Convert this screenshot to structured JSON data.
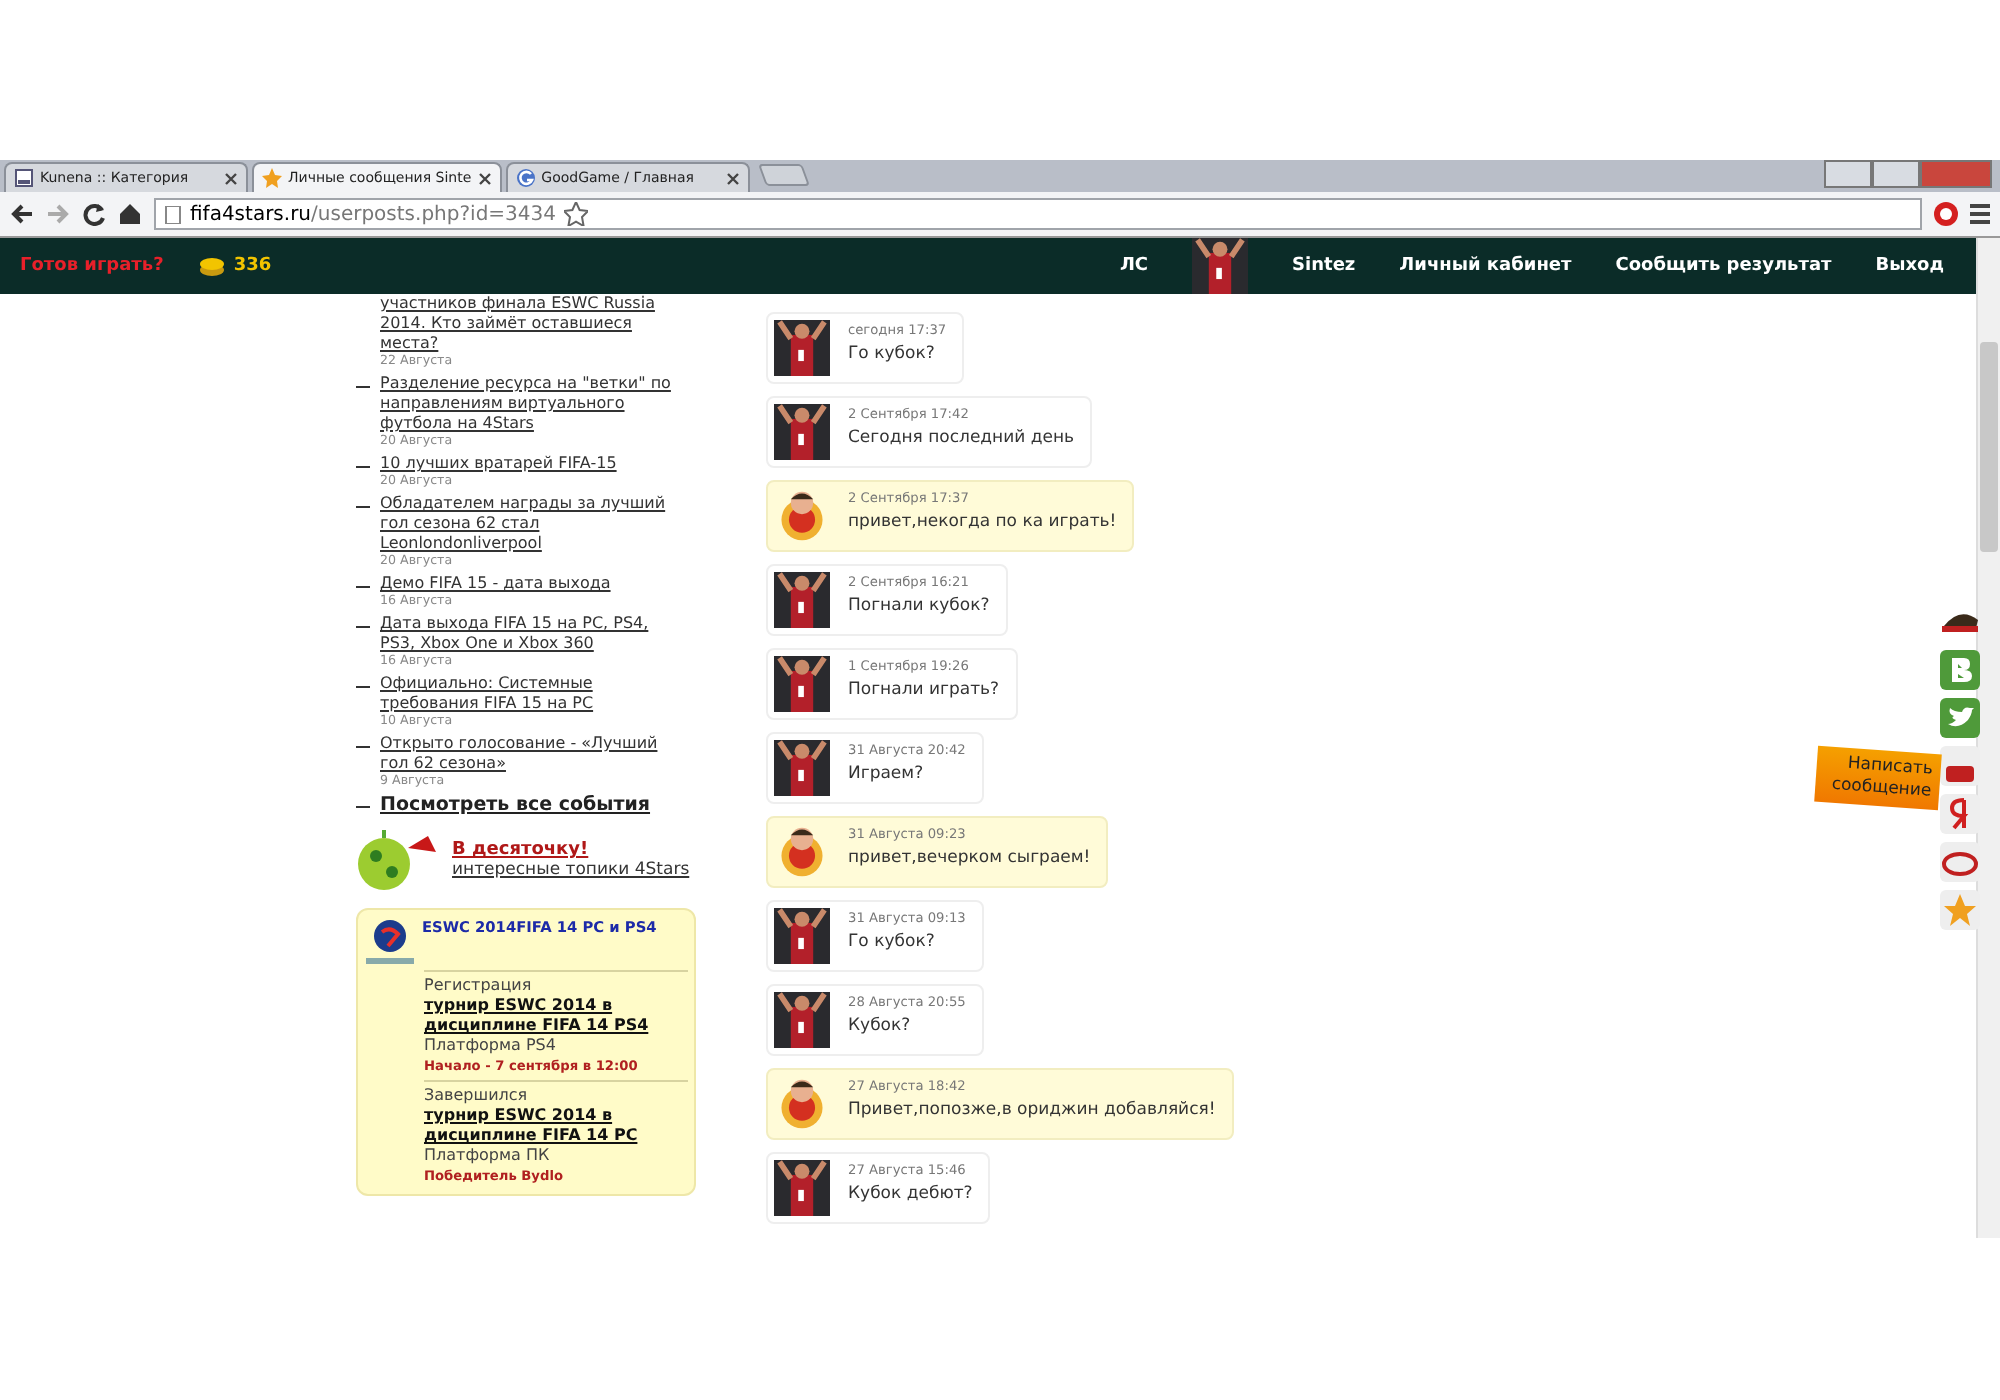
{
  "browser": {
    "tabs": [
      {
        "title": "Kunena :: Категория",
        "selected": false
      },
      {
        "title": "Личные сообщения Sinte",
        "selected": true
      },
      {
        "title": "GoodGame / Главная",
        "selected": false
      }
    ],
    "url": {
      "host": "fifa4stars.ru",
      "path": "/userposts.php?id=3434"
    }
  },
  "nav": {
    "play_link": "Готов играть?",
    "coins": "336",
    "items": [
      {
        "label": "ЛС",
        "kind": "link"
      },
      {
        "kind": "avatar"
      },
      {
        "label": "Sintez",
        "kind": "link"
      },
      {
        "label": "Личный кабинет",
        "kind": "link"
      },
      {
        "label": "Сообщить результат",
        "kind": "link"
      },
      {
        "label": "Выход",
        "kind": "link"
      }
    ]
  },
  "sidebar": {
    "news": [
      {
        "title": "участников финала ESWC Russia 2014. Кто займёт оставшиеся места?",
        "date": "22 Августа",
        "bullet": false
      },
      {
        "title": "Разделение ресурса на \"ветки\" по направлениям виртуального футбола на 4Stars",
        "date": "20 Августа",
        "bullet": true
      },
      {
        "title": "10 лучших вратарей FIFA-15",
        "date": "20 Августа",
        "bullet": true
      },
      {
        "title": "Обладателем награды за лучший гол сезона 62 стал Leonlondonliverpool",
        "date": "20 Августа",
        "bullet": true
      },
      {
        "title": "Демо FIFA 15 - дата выхода",
        "date": "16 Августа",
        "bullet": true
      },
      {
        "title": "Дата выхода FIFA 15 на PC, PS4, PS3, Xbox One и Xbox 360",
        "date": "16 Августа",
        "bullet": true
      },
      {
        "title": "Официально: Системные требования FIFA 15 на PC",
        "date": "10 Августа",
        "bullet": true
      },
      {
        "title": "Открыто голосование - «Лучший гол 62 сезона»",
        "date": "9 Августа",
        "bullet": true
      }
    ],
    "all_events": "Посмотреть все события",
    "promo": {
      "title": "В десяточку!",
      "subtitle": "интересные топики 4Stars"
    },
    "tournaments": {
      "title": "ESWC 2014FIFA 14 PC и PS4",
      "entries": [
        {
          "status": "Регистрация",
          "name": "турнир ESWC 2014 в дисциплине FIFA 14 PS4",
          "platform": "Платформа PS4",
          "note": "Начало - 7 сентября в 12:00"
        },
        {
          "status": "Завершился",
          "name": "турнир ESWC 2014 в дисциплине FIFA 14 PC",
          "platform": "Платформа ПК",
          "note": "Победитель Bydlo"
        }
      ]
    }
  },
  "messages": [
    {
      "kind": "incoming",
      "time": "сегодня 17:37",
      "text": "Го кубок?"
    },
    {
      "kind": "incoming",
      "time": "2 Сентября 17:42",
      "text": "Сегодня последний день"
    },
    {
      "kind": "outgoing",
      "time": "2 Сентября 17:37",
      "text": "привет,некогда по ка играть!"
    },
    {
      "kind": "incoming",
      "time": "2 Сентября 16:21",
      "text": "Погнали кубок?"
    },
    {
      "kind": "incoming",
      "time": "1 Сентября 19:26",
      "text": "Погнали играть?"
    },
    {
      "kind": "incoming",
      "time": "31 Августа 20:42",
      "text": "Играем?"
    },
    {
      "kind": "outgoing",
      "time": "31 Августа 09:23",
      "text": "привет,вечерком сыграем!"
    },
    {
      "kind": "incoming",
      "time": "31 Августа 09:13",
      "text": "Го кубок?"
    },
    {
      "kind": "incoming",
      "time": "28 Августа 20:55",
      "text": "Кубок?"
    },
    {
      "kind": "outgoing",
      "time": "27 Августа 18:42",
      "text": "Привет,попозже,в ориджин добавляйся!"
    },
    {
      "kind": "incoming",
      "time": "27 Августа 15:46",
      "text": "Кубок дебют?"
    }
  ],
  "write_button": "Написать сообщение"
}
